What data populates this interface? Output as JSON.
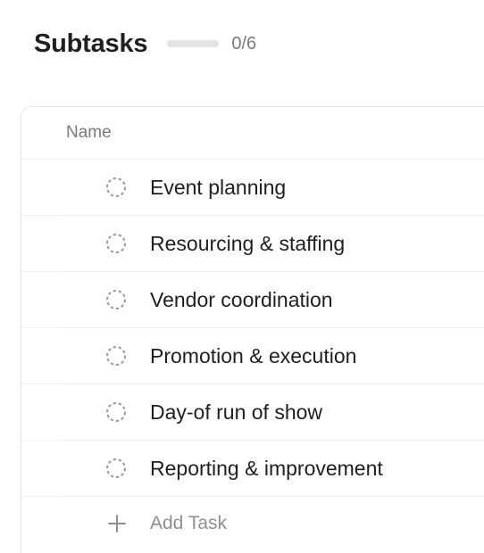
{
  "subtasks": {
    "title": "Subtasks",
    "completed": 0,
    "total": 6,
    "count_label": "0/6",
    "progress_fraction": 0.0
  },
  "table": {
    "column_name": "Name",
    "rows": [
      {
        "name": "Event planning",
        "status_icon": "dashed-circle-icon"
      },
      {
        "name": "Resourcing & staffing",
        "status_icon": "dashed-circle-icon"
      },
      {
        "name": "Vendor coordination",
        "status_icon": "dashed-circle-icon"
      },
      {
        "name": "Promotion & execution",
        "status_icon": "dashed-circle-icon"
      },
      {
        "name": "Day-of run of show",
        "status_icon": "dashed-circle-icon"
      },
      {
        "name": "Reporting & improvement",
        "status_icon": "dashed-circle-icon"
      }
    ],
    "add_task_label": "Add Task",
    "add_task_icon": "plus-icon"
  },
  "colors": {
    "text": "#1f1f1f",
    "muted": "#7a7a7a",
    "progress_track": "#e3e3e3",
    "divider": "#ececec"
  }
}
